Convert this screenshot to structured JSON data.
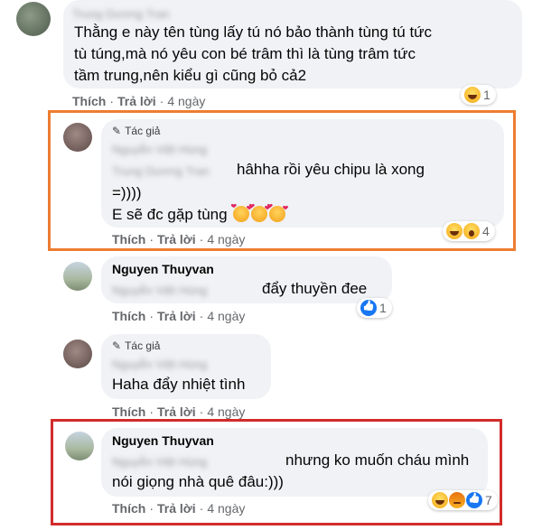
{
  "comments": [
    {
      "name": "Trung Dương Tran",
      "lines": [
        "Thằng e này tên tùng lấy tú nó bảo thành tùng tú tức",
        "tù túng,mà nó yêu con bé trâm thì là tùng trâm tức",
        "tầm trung,nên kiểu gì cũng bỏ cả2"
      ],
      "like": "Thích",
      "reply": "Trả lời",
      "dot": "·",
      "time": "4 ngày",
      "reaction_count": "1"
    },
    {
      "author_badge": "Tác giả",
      "tag_line1": "Nguyễn Việt Hùng",
      "tag_line2": "Trung Dương Tran",
      "line1": "hâhha rồi yêu chipu là xong",
      "line2": "=))))",
      "line3": "E sẽ đc gặp tùng",
      "like": "Thích",
      "reply": "Trả lời",
      "dot": "·",
      "time": "4 ngày",
      "reaction_count": "4"
    },
    {
      "name": "Nguyen Thuyvan",
      "tag": "Nguyễn Việt Hùng",
      "text": "đẩy thuyền đee",
      "like": "Thích",
      "reply": "Trả lời",
      "dot": "·",
      "time": "4 ngày",
      "reaction_count": "1"
    },
    {
      "author_badge": "Tác giả",
      "tag": "Nguyễn Việt Hùng",
      "text": "Haha đẩy nhiệt tình",
      "like": "Thích",
      "reply": "Trả lời",
      "dot": "·",
      "time": "4 ngày"
    },
    {
      "name": "Nguyen Thuyvan",
      "tag": "Nguyễn Việt Hùng",
      "line1": "nhưng ko muốn cháu mình",
      "line2": "nói giọng nhà quê đâu:)))",
      "like": "Thích",
      "reply": "Trả lời",
      "dot": "·",
      "time": "4 ngày",
      "reaction_count": "7"
    }
  ],
  "colors": {
    "orange_box": "#ed7d31",
    "red_box": "#d22b2b",
    "bubble": "#f0f2f5",
    "meta": "#65676b"
  }
}
